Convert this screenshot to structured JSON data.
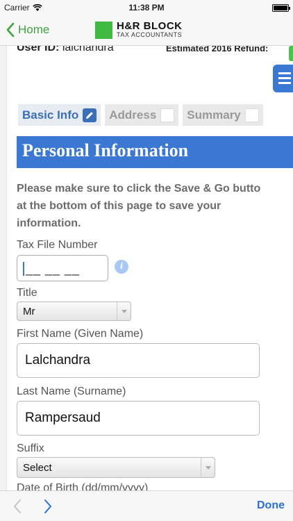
{
  "status_bar": {
    "carrier": "Carrier",
    "time": "11:38 PM",
    "battery_level": 1.0
  },
  "nav": {
    "back_label": "Home",
    "logo_brand": "H&R BLOCK",
    "logo_sub": "TAX ACCOUNTANTS"
  },
  "user": {
    "id_label": "User ID:",
    "id_value": "lalchandra",
    "refund_label": "Estimated 2016 Refund:"
  },
  "tabs": [
    {
      "label": "Basic Info",
      "active": true
    },
    {
      "label": "Address",
      "active": false
    },
    {
      "label": "Summary",
      "active": false
    }
  ],
  "section": {
    "title": "Personal Information",
    "notice_lines": [
      "Please make sure to click the Save & Go butto",
      "at the bottom of this page to save your",
      "information."
    ]
  },
  "form": {
    "tfn_label": "Tax File Number",
    "tfn_mask": "__ __ __",
    "title_label": "Title",
    "title_value": "Mr",
    "first_name_label": "First Name (Given Name)",
    "first_name_value": "Lalchandra",
    "last_name_label": "Last Name (Surname)",
    "last_name_value": "Rampersaud",
    "suffix_label": "Suffix",
    "suffix_value": "Select",
    "dob_label": "Date of Birth (dd/mm/yyyy)"
  },
  "toolbar": {
    "done_label": "Done"
  },
  "colors": {
    "brand_green": "#3fba3f",
    "accent_blue": "#3b78d3",
    "link_blue": "#2a6fd6"
  }
}
